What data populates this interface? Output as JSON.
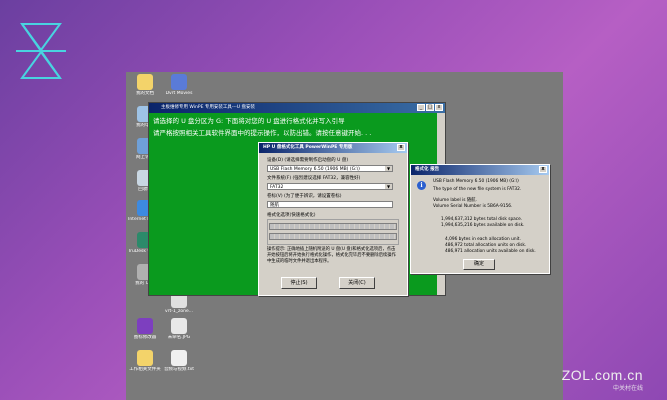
{
  "desktop_icons": [
    {
      "label": "我的文档",
      "color": "#f3d36a"
    },
    {
      "label": "Dvrt Movies",
      "color": "#5a7bd8"
    },
    {
      "label": "我的电脑",
      "color": "#9ec3e6"
    },
    {
      "label": "网上邻居",
      "color": "#6fa0d8"
    },
    {
      "label": "回收站",
      "color": "#c9d7e3"
    },
    {
      "label": "Internet Explorer",
      "color": "#3d8ae0"
    },
    {
      "label": "TruDesk viewer",
      "color": "#2c8a6a"
    },
    {
      "label": "我的 U 盘",
      "color": "#b0b0b0"
    },
    {
      "label": "vrt-1_zone...",
      "color": "#e0e0e0"
    },
    {
      "label": "图标修改器",
      "color": "#7d3fbf"
    },
    {
      "label": "未命名.JPG",
      "color": "#e8e8e8"
    },
    {
      "label": "工作相关文件夹",
      "color": "#f3d36a"
    },
    {
      "label": "音频与视频.txt",
      "color": "#f0f0f0"
    }
  ],
  "cmd": {
    "title": "主板维修专用 WinPE 专用安装工具---U 盘安装",
    "lines": [
      "请选择的 U 盘分区为 G: 下面将对您的 U 盘进行格式化并写入引导",
      "请严格按照相关工具软件界面中的提示操作，以防出错。请按任意键开始. . ."
    ],
    "controls": [
      "_",
      "□",
      "x"
    ]
  },
  "format_dialog": {
    "title": "HP U 盘格式化工具 PowerWinPE 专用版",
    "device_label": "设备(D) (请选择需要制作启动盘的 U 盘)",
    "device_value": "USB Flash Memory 6.50 (1906 MB) (G:\\)",
    "fs_label": "文件系统(F) (强烈建议选择 FAT32，兼容性好)",
    "fs_value": "FAT32",
    "volume_label": "卷标(V) (为了便于辨识，请设置卷标)",
    "volume_value": "随航",
    "options_label": "格式化选项(快速格式化)",
    "description": "操作提示: 正确地插上随机附送的 U 盘(U 盘)和格式化选项后，点击开始按钮后将开始执行格式化操作，格式化完毕后不要删除后续操作中生成的临时文件并退出本程序。",
    "start_button": "停止(S)",
    "close_button": "关闭(C)"
  },
  "report": {
    "title": "格式化 报告",
    "device": "USB Flash Memory 6.50 (1906 MB) (G:\\)",
    "lines1": [
      "The type of the new file system is FAT32.",
      "",
      "Volume label is 随航.",
      "Volume Serial Number is 5B6A-9156."
    ],
    "lines2": [
      "1,994,637,312 bytes total disk space.",
      "1,994,635,216 bytes available on disk."
    ],
    "lines3": [
      "4,096 bytes in each allocation unit.",
      "486,972 total allocation units on disk.",
      "486,971 allocation units available on disk."
    ],
    "ok_button": "确定"
  },
  "watermark": {
    "main": "ZOL.com.cn",
    "sub": "中关村在线"
  }
}
